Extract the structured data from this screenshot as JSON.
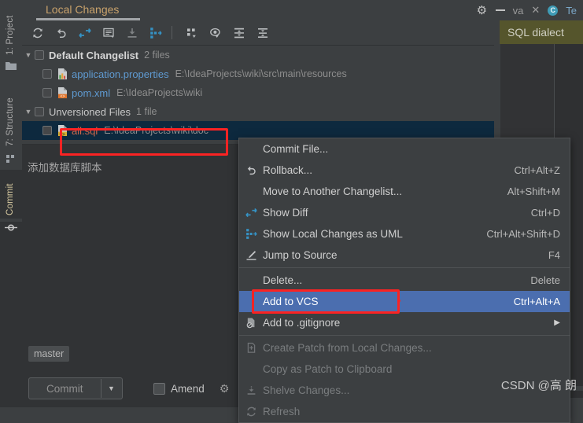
{
  "window": {
    "tab_label": "Local Changes",
    "right_tab_truncated": "va",
    "right_tab2_truncated": "Te",
    "close_icon": "close-icon",
    "gear_icon": "gear-icon",
    "minimize_icon": "minimize-icon"
  },
  "notification": {
    "sql_dialect": "SQL dialect"
  },
  "toolbar": {
    "buttons": [
      {
        "name": "refresh-icon",
        "title": "Refresh"
      },
      {
        "name": "rollback-icon",
        "title": "Rollback"
      },
      {
        "name": "show-diff-icon",
        "title": "Show Diff"
      },
      {
        "name": "commit-message-icon",
        "title": "Edit Message"
      },
      {
        "name": "shelve-icon",
        "title": "Shelve Silently"
      },
      {
        "name": "uml-icon",
        "title": "Show Local Changes as UML"
      },
      {
        "name": "group-by-icon",
        "title": "Group By"
      },
      {
        "name": "preview-icon",
        "title": "Preview Diff"
      },
      {
        "name": "expand-all-icon",
        "title": "Expand All"
      },
      {
        "name": "collapse-all-icon",
        "title": "Collapse All"
      }
    ]
  },
  "sidebar": {
    "items": [
      {
        "label": "1: Project",
        "icon": "project-folder-icon",
        "active": false
      },
      {
        "label": "7: Structure",
        "icon": "structure-icon",
        "active": false
      },
      {
        "label": "Commit",
        "icon": "commit-node-icon",
        "active": true
      }
    ]
  },
  "tree": {
    "changelists": [
      {
        "name": "Default Changelist",
        "count": "2 files",
        "expanded": true,
        "files": [
          {
            "name": "application.properties",
            "path": "E:\\IdeaProjects\\wiki\\src\\main\\resources",
            "icon": "properties-file-icon",
            "color": "#5f9ad1"
          },
          {
            "name": "pom.xml",
            "path": "E:\\IdeaProjects\\wiki",
            "icon": "maven-xml-file-icon",
            "color": "#5f9ad1"
          }
        ]
      },
      {
        "name": "Unversioned Files",
        "count": "1 file",
        "expanded": true,
        "files": [
          {
            "name": "all.sql",
            "path": "E:\\IdeaProjects\\wiki\\doc",
            "icon": "sql-file-icon",
            "color": "#cf6a4c",
            "selected": true
          }
        ]
      }
    ]
  },
  "commit_panel": {
    "message": "添加数据库脚本",
    "branch_chip": "master",
    "commit_button": "Commit",
    "commit_dropdown_icon": "chevron-down-icon",
    "amend_label": "Amend",
    "amend_checked": false,
    "settings_icon": "gear-icon"
  },
  "context_menu": {
    "items": [
      {
        "label": "Commit File...",
        "accelerator": "",
        "icon": "",
        "state": "normal",
        "mnemonic": "i"
      },
      {
        "label": "Rollback...",
        "accelerator": "Ctrl+Alt+Z",
        "icon": "rollback-icon",
        "state": "normal",
        "mnemonic": "R"
      },
      {
        "label": "Move to Another Changelist...",
        "accelerator": "Alt+Shift+M",
        "icon": "",
        "state": "normal"
      },
      {
        "label": "Show Diff",
        "accelerator": "Ctrl+D",
        "icon": "show-diff-icon",
        "state": "normal"
      },
      {
        "label": "Show Local Changes as UML",
        "accelerator": "Ctrl+Alt+Shift+D",
        "icon": "uml-icon",
        "state": "normal"
      },
      {
        "label": "Jump to Source",
        "accelerator": "F4",
        "icon": "jump-to-source-icon",
        "state": "normal"
      },
      {
        "separator": true
      },
      {
        "label": "Delete...",
        "accelerator": "Delete",
        "icon": "",
        "state": "normal",
        "mnemonic": "D"
      },
      {
        "label": "Add to VCS",
        "accelerator": "Ctrl+Alt+A",
        "icon": "",
        "state": "highlighted"
      },
      {
        "label": "Add to .gitignore",
        "accelerator": "",
        "icon": "gitignore-icon",
        "state": "normal",
        "submenu": true
      },
      {
        "separator": true
      },
      {
        "label": "Create Patch from Local Changes...",
        "accelerator": "",
        "icon": "patch-icon",
        "state": "disabled"
      },
      {
        "label": "Copy as Patch to Clipboard",
        "accelerator": "",
        "icon": "",
        "state": "disabled"
      },
      {
        "label": "Shelve Changes...",
        "accelerator": "",
        "icon": "shelve-icon",
        "state": "disabled"
      },
      {
        "label": "Refresh",
        "accelerator": "",
        "icon": "refresh-icon",
        "state": "disabled"
      }
    ]
  },
  "annotations": {
    "highlight_color": "#fb2323",
    "boxes": [
      "selected-file-row",
      "add-to-vcs-menu-item"
    ]
  },
  "watermark": "CSDN @高 朗",
  "colors": {
    "background": "#3c3f41",
    "selection": "#0d293e",
    "menu_highlight": "#4b6eaf",
    "notification": "#55552c",
    "accent_blue": "#5f9ad1",
    "tab_active": "#c9a26b"
  }
}
